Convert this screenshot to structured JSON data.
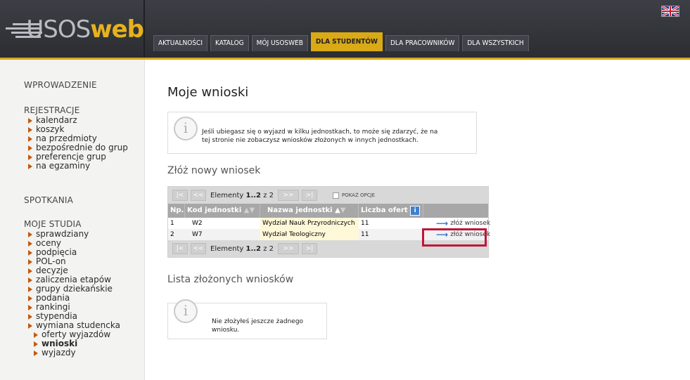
{
  "header": {
    "logo_text_a": "USOS",
    "logo_text_b": "web",
    "language_icon": "uk-flag-icon",
    "tabs": [
      {
        "label": "AKTUALNOŚCI"
      },
      {
        "label": "KATALOG"
      },
      {
        "label": "MÓJ USOSWEB"
      },
      {
        "label": "DLA STUDENTÓW",
        "active": true
      },
      {
        "label": "DLA PRACOWNIKÓW"
      },
      {
        "label": "DLA WSZYSTKICH"
      }
    ]
  },
  "sidebar": {
    "sections": [
      {
        "title": "WPROWADZENIE"
      },
      {
        "title": "REJESTRACJE",
        "items": [
          "kalendarz",
          "koszyk",
          "na przedmioty",
          "bezpośrednie do grup",
          "preferencje grup",
          "na egzaminy"
        ]
      },
      {
        "title": "SPOTKANIA"
      },
      {
        "title": "MOJE STUDIA",
        "items": [
          "sprawdziany",
          "oceny",
          "podpięcia",
          "POL-on",
          "decyzje",
          "zaliczenia etapów",
          "grupy dziekańskie",
          "podania",
          "rankingi",
          "stypendia",
          "wymiana studencka"
        ],
        "subitems": [
          "oferty wyjazdów",
          "wnioski",
          "wyjazdy"
        ]
      }
    ]
  },
  "main": {
    "title": "Moje wnioski",
    "info1": {
      "line1": "Jeśli ubiegasz się o wyjazd w kilku jednostkach, to może się zdarzyć, że na",
      "line2": "tej stronie nie zobaczysz wniosków złożonych w innych jednostkach."
    },
    "section1_title": "Złóż nowy wniosek",
    "pager": {
      "first": "|<",
      "prev": "<<",
      "next": ">>",
      "last": ">|",
      "label_prefix": "Elementy ",
      "range": "1..2",
      "label_suffix": " z 2",
      "show_options": "POKAŻ OPCJE"
    },
    "table": {
      "columns": [
        "Np.",
        "Kod jednostki",
        "Nazwa jednostki",
        "Liczba ofert"
      ],
      "rows": [
        {
          "np": "1",
          "kod": "W2",
          "nazwa": "Wydział Nauk Przyrodniczych",
          "liczba": "11",
          "action": "złóż wniosek"
        },
        {
          "np": "2",
          "kod": "W7",
          "nazwa": "Wydział Teologiczny",
          "liczba": "11",
          "action": "złóż wniosek"
        }
      ]
    },
    "section2_title": "Lista złożonych wniosków",
    "info2": {
      "line1": "Nie złożyłeś jeszcze żadnego wniosku."
    }
  },
  "colors": {
    "accent": "#d9a916",
    "header_bg": "#2b2d31",
    "bullet": "#c4580c",
    "highlight": "#c0163a",
    "table_header": "#a7a7a7"
  }
}
